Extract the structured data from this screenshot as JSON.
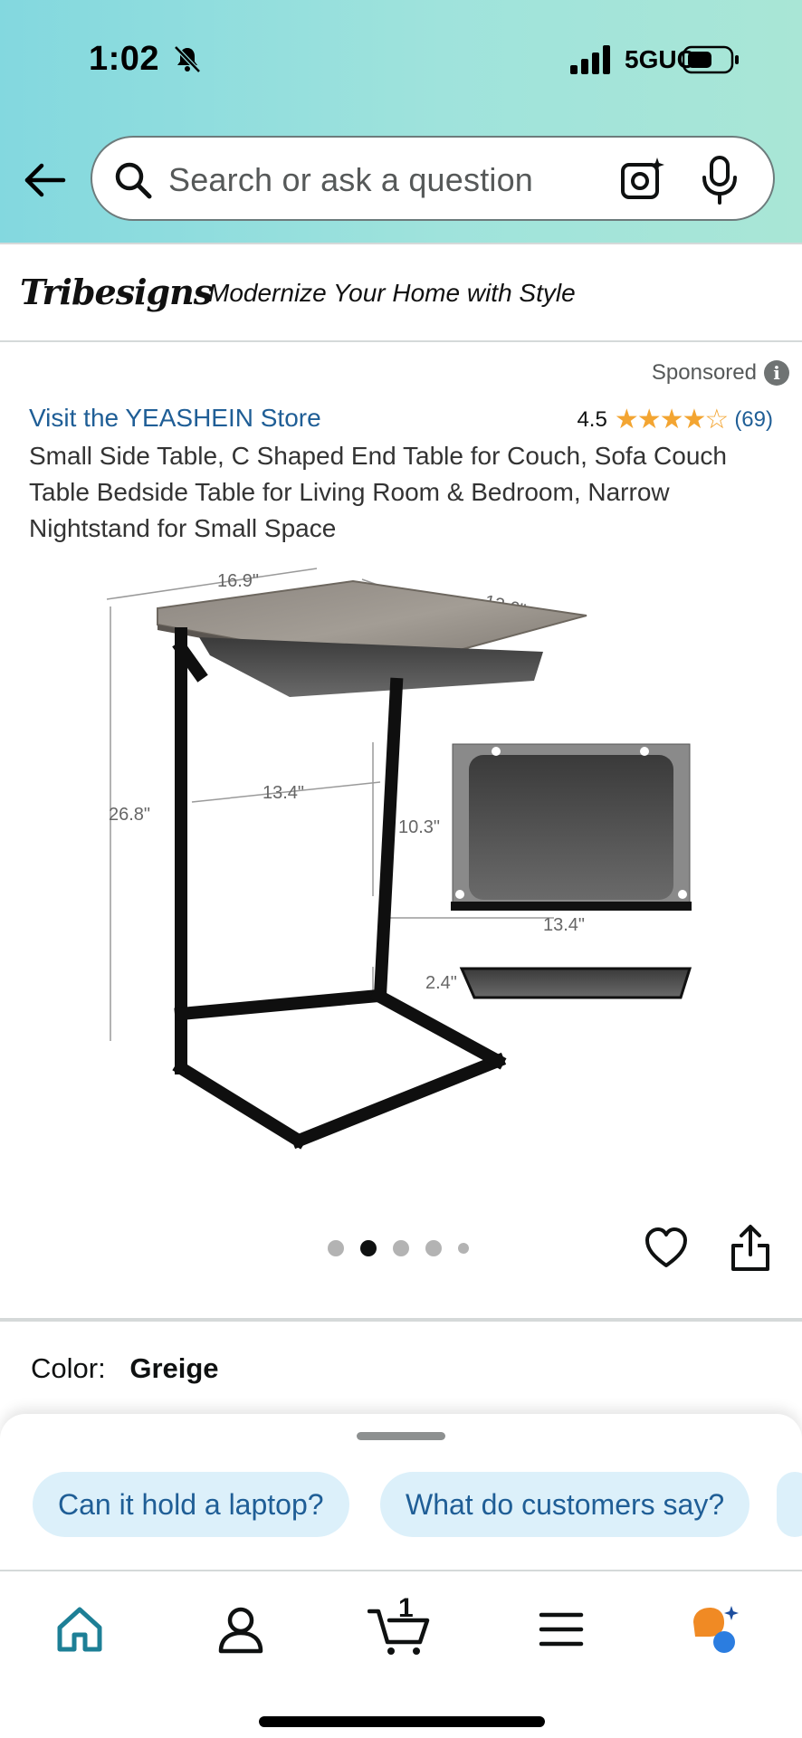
{
  "status_bar": {
    "time": "1:02",
    "network": "5GUC"
  },
  "search": {
    "placeholder": "Search or ask a question"
  },
  "brand_banner": {
    "logo_text": "Tribesigns",
    "tagline": "Modernize Your Home with Style"
  },
  "product": {
    "sponsored_label": "Sponsored",
    "store_link": "Visit the YEASHEIN Store",
    "rating": "4.5",
    "stars": "★★★★☆",
    "rating_count": "(69)",
    "title": "Small Side Table, C Shaped End Table for Couch, Sofa Couch Table Bedside Table for Living Room & Bedroom, Narrow Nightstand for Small Space",
    "dimensions": {
      "top_width": "16.9\"",
      "top_depth": "12.6\"",
      "height": "26.8\"",
      "leg_span": "13.4\"",
      "drawer_height": "10.3\"",
      "drawer_width": "13.4\"",
      "drawer_depth": "2.4\""
    }
  },
  "carousel": {
    "total": 5,
    "active_index": 1
  },
  "options": {
    "color_label": "Color:",
    "color_value": "Greige"
  },
  "suggestions": [
    "Can it hold a laptop?",
    "What do customers say?"
  ],
  "nav": {
    "cart_count": "1"
  },
  "colors": {
    "accent_link": "#1f5e96",
    "star": "#f3a532",
    "chip_bg": "#dcf0fa",
    "home_active": "#1d7f96"
  }
}
